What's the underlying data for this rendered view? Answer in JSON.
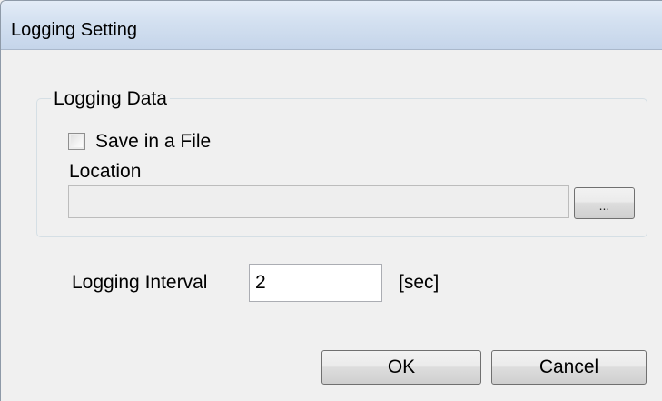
{
  "window": {
    "title": "Logging Setting"
  },
  "logging_data": {
    "group_label": "Logging Data",
    "save_in_file": {
      "label": "Save in a File",
      "checked": false
    },
    "location": {
      "label": "Location",
      "value": "",
      "enabled": false
    },
    "browse_button_label": "..."
  },
  "interval": {
    "label": "Logging Interval",
    "value": "2",
    "unit": "[sec]"
  },
  "buttons": {
    "ok_label": "OK",
    "cancel_label": "Cancel"
  },
  "icons": {
    "checkbox": "checkbox-unchecked-icon"
  }
}
